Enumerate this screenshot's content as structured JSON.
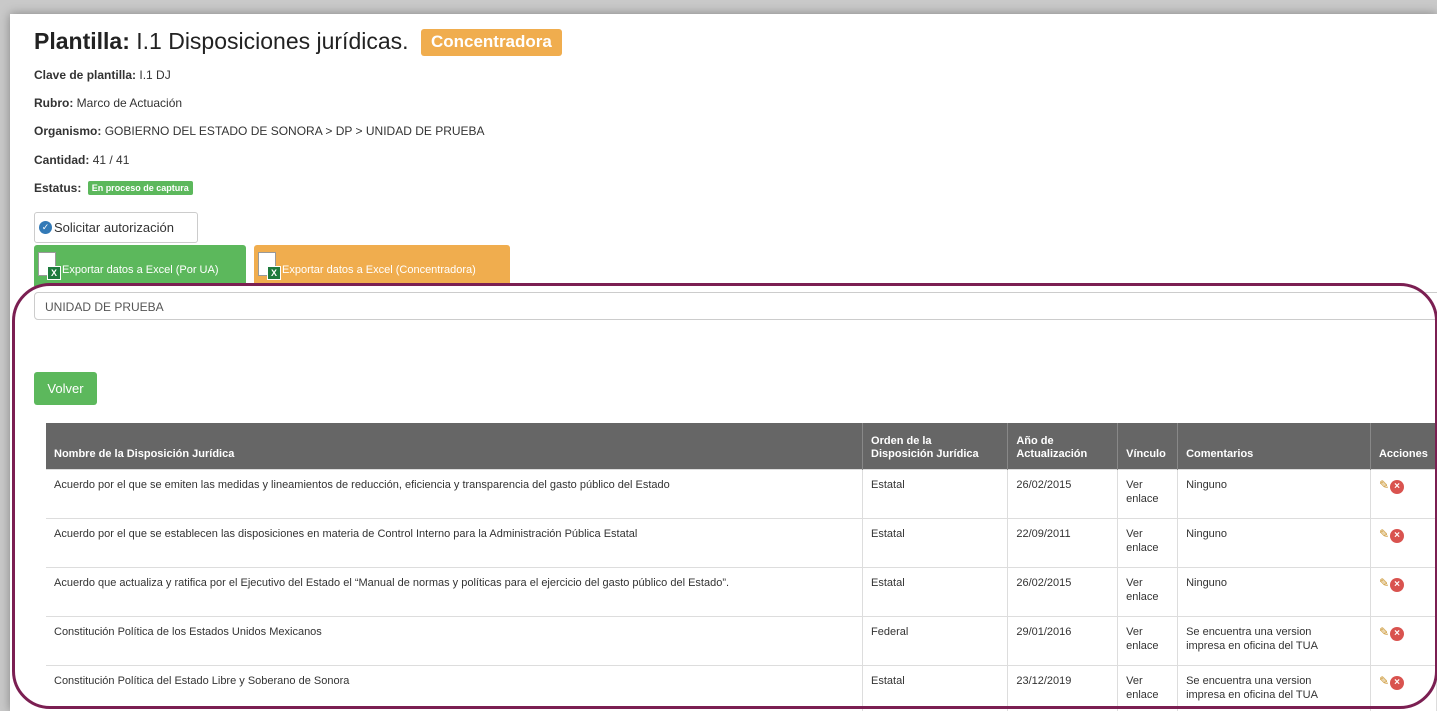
{
  "header": {
    "title_prefix": "Plantilla:",
    "title": "I.1 Disposiciones jurídicas.",
    "badge": "Concentradora"
  },
  "info": {
    "clave_label": "Clave de plantilla:",
    "clave_value": "I.1 DJ",
    "rubro_label": "Rubro:",
    "rubro_value": "Marco de Actuación",
    "organismo_label": "Organismo:",
    "organismo_value": "GOBIERNO DEL ESTADO DE SONORA > DP > UNIDAD DE PRUEBA",
    "cantidad_label": "Cantidad:",
    "cantidad_value": "41 / 41",
    "estatus_label": "Estatus:",
    "estatus_value": "En proceso de captura"
  },
  "buttons": {
    "solicitar": "Solicitar autorización",
    "export_ua": "Exportar datos a Excel (Por UA)",
    "export_conc": "Exportar datos a Excel (Concentradora)",
    "volver": "Volver"
  },
  "unidad": "UNIDAD DE PRUEBA",
  "table": {
    "headers": {
      "nombre": "Nombre de la Disposición Jurídica",
      "orden_1": "Orden de la",
      "orden_2": "Disposición Jurídica",
      "anio_1": "Año de",
      "anio_2": "Actualización",
      "vinculo": "Vínculo",
      "comentarios": "Comentarios",
      "acciones": "Acciones"
    },
    "rows": [
      {
        "nombre": "Acuerdo por el que se emiten las medidas y lineamientos de reducción, eficiencia y transparencia del gasto público del Estado",
        "orden": "Estatal",
        "anio": "26/02/2015",
        "vinculo_1": "Ver",
        "vinculo_2": "enlace",
        "comentario_1": "Ninguno",
        "comentario_2": ""
      },
      {
        "nombre": "Acuerdo por el que se establecen las disposiciones en materia de Control Interno para la Administración Pública Estatal",
        "orden": "Estatal",
        "anio": "22/09/2011",
        "vinculo_1": "Ver",
        "vinculo_2": "enlace",
        "comentario_1": "Ninguno",
        "comentario_2": ""
      },
      {
        "nombre": "Acuerdo que actualiza y ratifica por el Ejecutivo del Estado el “Manual de normas y políticas para el ejercicio del gasto público del Estado”.",
        "orden": "Estatal",
        "anio": "26/02/2015",
        "vinculo_1": "Ver",
        "vinculo_2": "enlace",
        "comentario_1": "Ninguno",
        "comentario_2": ""
      },
      {
        "nombre": "Constitución Política de los Estados Unidos Mexicanos",
        "orden": "Federal",
        "anio": "29/01/2016",
        "vinculo_1": "Ver",
        "vinculo_2": "enlace",
        "comentario_1": "Se encuentra una version",
        "comentario_2": "impresa en oficina del TUA"
      },
      {
        "nombre": "Constitución Política del Estado Libre y Soberano de Sonora",
        "orden": "Estatal",
        "anio": "23/12/2019",
        "vinculo_1": "Ver",
        "vinculo_2": "enlace",
        "comentario_1": "Se encuentra una version",
        "comentario_2": "impresa en oficina del TUA"
      }
    ]
  },
  "icons": {
    "check": "check-circle-icon",
    "excel": "excel-file-icon",
    "edit": "pencil-icon",
    "delete": "delete-circle-icon"
  },
  "colors": {
    "warning": "#f0ad4e",
    "success": "#5cb85c",
    "primary": "#337ab7",
    "danger": "#d9534f",
    "table_header": "#666666",
    "highlight": "#7b1f52"
  }
}
